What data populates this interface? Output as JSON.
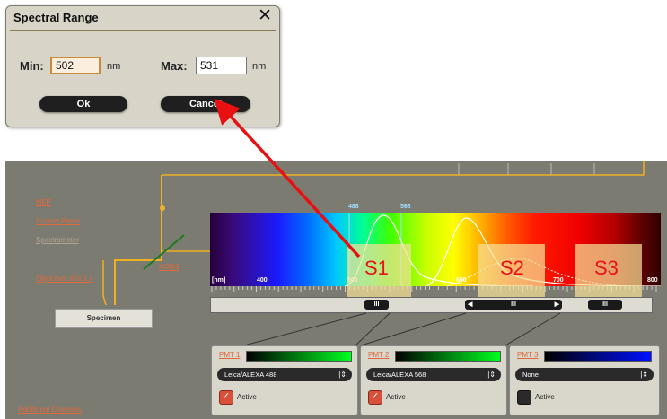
{
  "dialog": {
    "title": "Spectral Range",
    "close_glyph": "✕",
    "min_label": "Min:",
    "min_value": "502",
    "max_label": "Max:",
    "max_value": "531",
    "unit": "nm",
    "ok_label": "Ok",
    "cancel_label": "Cancel"
  },
  "left_menu": {
    "mfp": "MFP",
    "control_panel": "Control Panel",
    "spectrometer": "Spectrometer",
    "objective": "Objective: 63x 1.4",
    "aobs": "AOBS",
    "specimen": "Specimen",
    "additional_channels": "Additional Channels"
  },
  "spectrum": {
    "unit_label": "[nm]",
    "ticks": [
      "400",
      "500",
      "600",
      "700",
      "800"
    ],
    "regions": [
      "S1",
      "S2",
      "S3"
    ],
    "laser_lines": [
      "488",
      "568"
    ]
  },
  "slider": {
    "knob_glyph": "III",
    "left_arrow": "◀",
    "right_arrow": "▶"
  },
  "pmts": [
    {
      "name": "PMT 1",
      "dye": "Leica/ALEXA 488",
      "active_label": "Active",
      "active": true,
      "color": "#00ff20"
    },
    {
      "name": "PMT 2",
      "dye": "Leica/ALEXA 568",
      "active_label": "Active",
      "active": true,
      "color": "#00ff20"
    },
    {
      "name": "PMT 3",
      "dye": "None",
      "active_label": "Active",
      "active": false,
      "color": "#0010ff"
    }
  ],
  "colors": {
    "annotation_arrow": "#e81010",
    "link": "#e0693a",
    "beam": "#f0b020"
  }
}
